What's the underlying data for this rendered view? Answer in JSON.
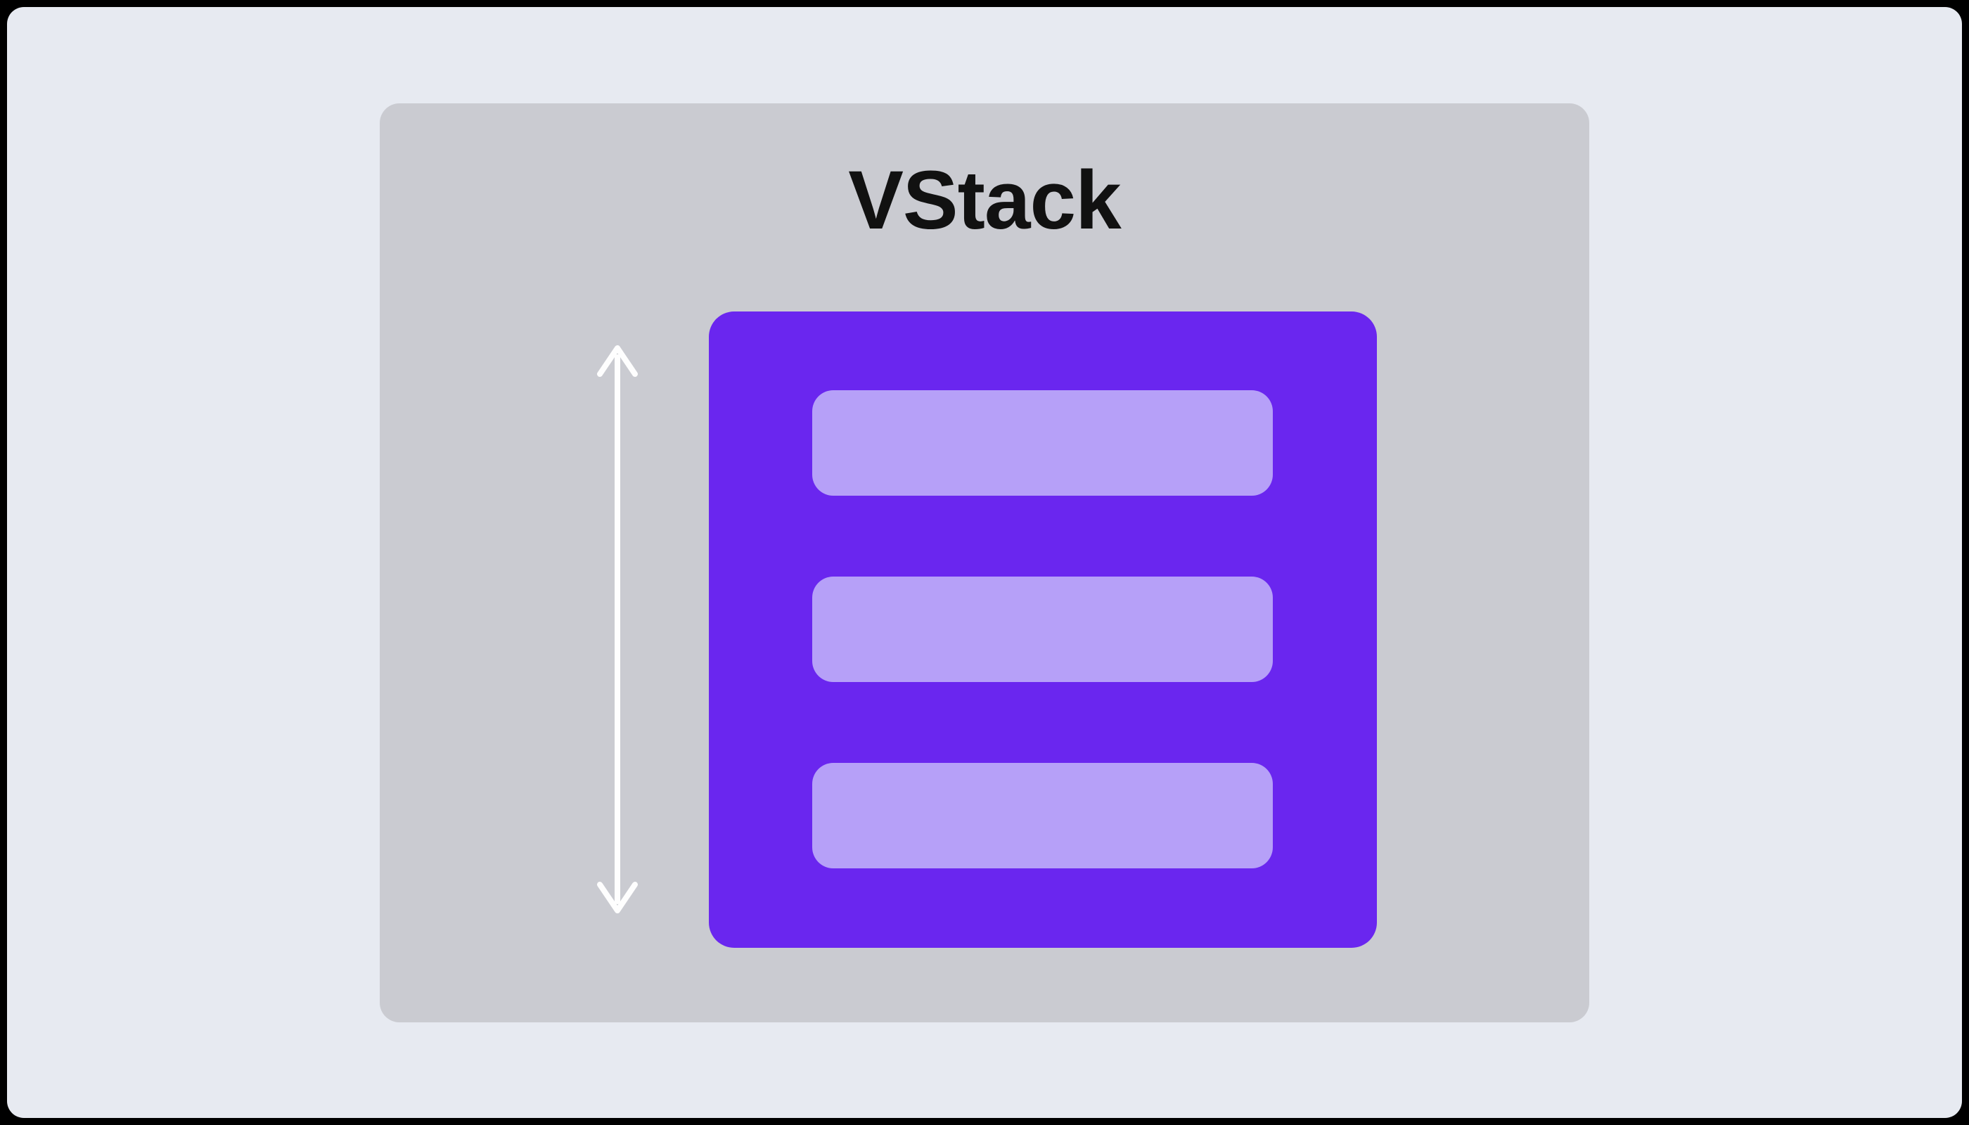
{
  "diagram": {
    "title": "VStack",
    "item_count": 3,
    "colors": {
      "page_bg": "#e7eaf1",
      "panel_bg": "#cacbd1",
      "stack_bg": "#6a26ef",
      "item_bg": "#b6a0f8",
      "arrow": "#fefefe"
    }
  }
}
